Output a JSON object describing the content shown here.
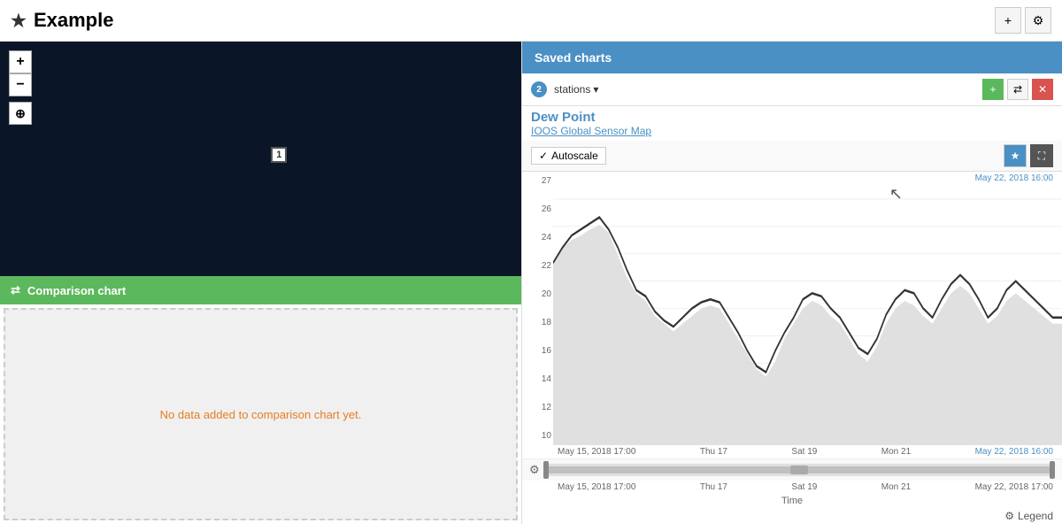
{
  "app": {
    "title": "Example",
    "star": "★"
  },
  "toolbar": {
    "add_label": "+",
    "settings_label": "⚙"
  },
  "map": {
    "zoom_in": "+",
    "zoom_out": "−",
    "zoom_box": "⊕",
    "marker_label": "1"
  },
  "comparison": {
    "header": "Comparison chart",
    "icon": "⇄",
    "empty_text": "No data added to comparison chart yet."
  },
  "saved_charts": {
    "header": "Saved charts"
  },
  "chart": {
    "station_count": "2",
    "stations_label": "stations",
    "dropdown_arrow": "▾",
    "add_btn": "+",
    "shuffle_btn": "⇄",
    "close_btn": "✕",
    "title": "Dew Point",
    "subtitle": "IOOS Global Sensor Map",
    "autoscale_check": "✓",
    "autoscale_label": "Autoscale",
    "star_btn": "★",
    "expand_btn": "⛶",
    "gear_label": "⚙",
    "legend_label": "Legend",
    "legend_gear": "⚙",
    "time_end_label": "May 22, 2018 16:00",
    "time_axis_label": "Time",
    "y_labels": [
      "27",
      "26",
      "24",
      "22",
      "20",
      "18",
      "16",
      "14",
      "12",
      "10"
    ],
    "x_labels_top": [
      "May 15, 2018 17:00",
      "Thu 17",
      "Sat 19",
      "Mon 21",
      "May 22, 2018 16:00"
    ],
    "x_labels_bottom": [
      "May 15, 2018 17:00",
      "Thu 17",
      "Sat 19",
      "Mon 21",
      "May 22, 2018 17:00"
    ]
  },
  "colors": {
    "map_bg": "#0a1628",
    "comparison_header": "#5cb85c",
    "saved_charts_header": "#4a90c4",
    "chart_line": "#333",
    "chart_fill": "#d0d0d0",
    "dew_point_color": "#4a90c4"
  }
}
